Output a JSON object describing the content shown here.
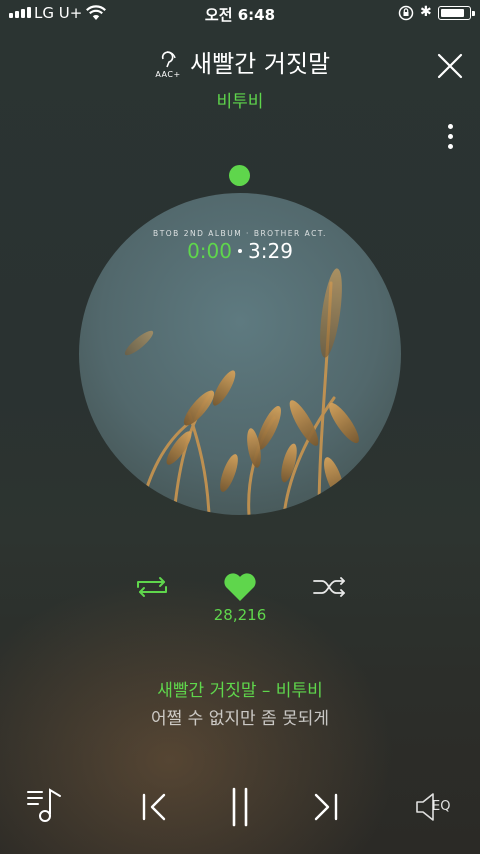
{
  "status_bar": {
    "carrier": "LG U+",
    "time": "오전 6:48",
    "bluetooth": "✱"
  },
  "header": {
    "quality_label": "AAC+",
    "song_title": "새빨간 거짓말",
    "artist": "비투비"
  },
  "album": {
    "caption": "BTOB 2ND ALBUM · BROTHER ACT.",
    "current_time": "0:00",
    "total_time": "3:29",
    "progress": 0
  },
  "actions": {
    "like_count": "28,216"
  },
  "lyrics": {
    "current": "새빨간 거짓말 – 비투비",
    "next": "어쩔 수 없지만 좀 못되게"
  },
  "bottom": {
    "eq_label": "EQ"
  },
  "colors": {
    "accent": "#5fd64c",
    "text": "#ffffff"
  },
  "icons": [
    "signal-icon",
    "wifi-icon",
    "rotation-lock-icon",
    "bluetooth-icon",
    "battery-icon",
    "aac-icon",
    "close-icon",
    "more-icon",
    "repeat-icon",
    "heart-icon",
    "shuffle-icon",
    "playlist-icon",
    "previous-icon",
    "pause-icon",
    "next-icon",
    "eq-icon"
  ]
}
